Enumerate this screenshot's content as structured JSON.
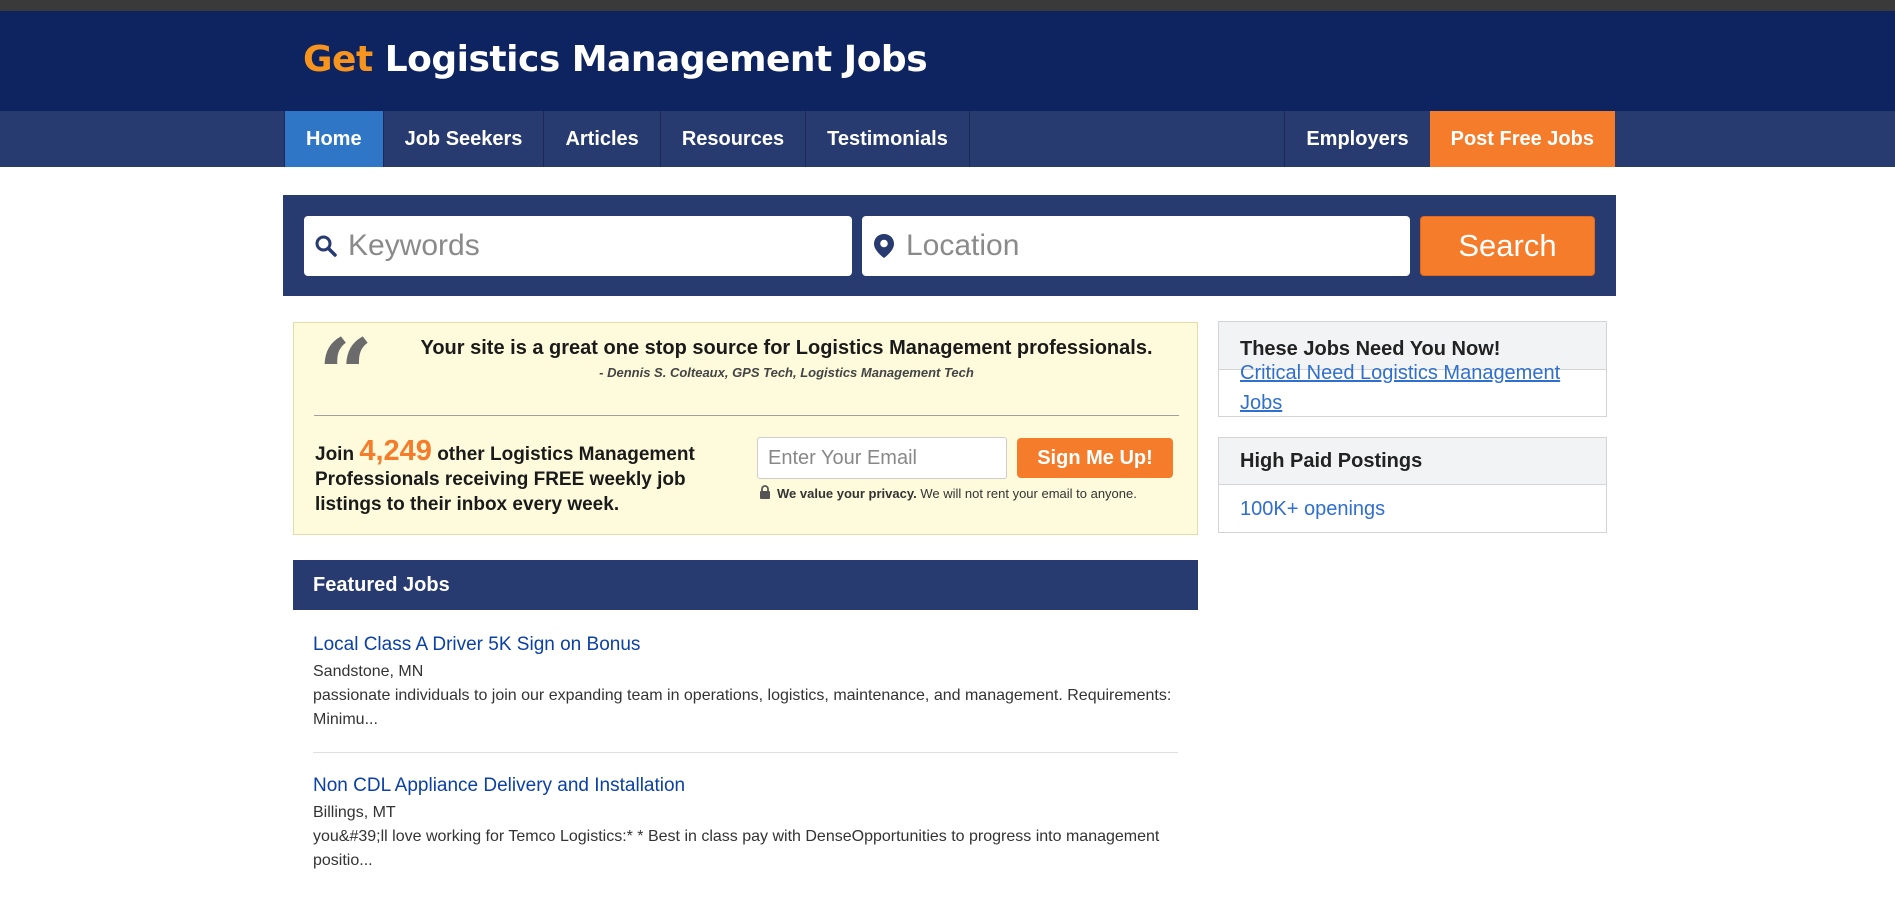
{
  "header": {
    "logo_prefix": "Get",
    "logo_rest": " Logistics Management Jobs"
  },
  "nav": {
    "items": [
      "Home",
      "Job Seekers",
      "Articles",
      "Resources",
      "Testimonials"
    ],
    "right_items": [
      "Employers",
      "Post Free Jobs"
    ]
  },
  "search": {
    "keywords_placeholder": "Keywords",
    "location_placeholder": "Location",
    "button_label": "Search"
  },
  "promo": {
    "quote": "Your site is a great one stop source for Logistics Management professionals.",
    "author": "- Dennis S. Colteaux, GPS Tech, Logistics Management Tech",
    "join_prefix": "Join",
    "count": "4,249",
    "join_suffix": "other Logistics Management Professionals receiving FREE weekly job listings to their inbox every week.",
    "email_placeholder": "Enter Your Email",
    "signup_label": "Sign Me Up!",
    "privacy_bold": "We value your privacy.",
    "privacy_text": "We will not rent your email to anyone."
  },
  "featured": {
    "title": "Featured Jobs",
    "jobs": [
      {
        "title": "Local Class A Driver 5K Sign on Bonus",
        "location": "Sandstone, MN",
        "description": "passionate individuals to join our expanding team in operations, logistics, maintenance, and management. Requirements: Minimu..."
      },
      {
        "title": "Non CDL Appliance Delivery and Installation",
        "location": "Billings, MT",
        "description": "you&#39;ll love working for Temco Logistics:* * Best in class pay with DenseOpportunities to progress into management positio..."
      }
    ]
  },
  "sidebar": {
    "need_title": "These Jobs Need You Now!",
    "need_link": "Critical Need Logistics Management Jobs",
    "paid_title": "High Paid Postings",
    "paid_link": "100K+ openings"
  },
  "colors": {
    "navy": "#0e2461",
    "nav": "#283b70",
    "orange": "#f47c2a",
    "active": "#2f77c6"
  },
  "icons": {
    "keywords": "search-icon",
    "location": "map-pin-icon",
    "privacy": "lock-icon",
    "quote": "quote-icon"
  }
}
